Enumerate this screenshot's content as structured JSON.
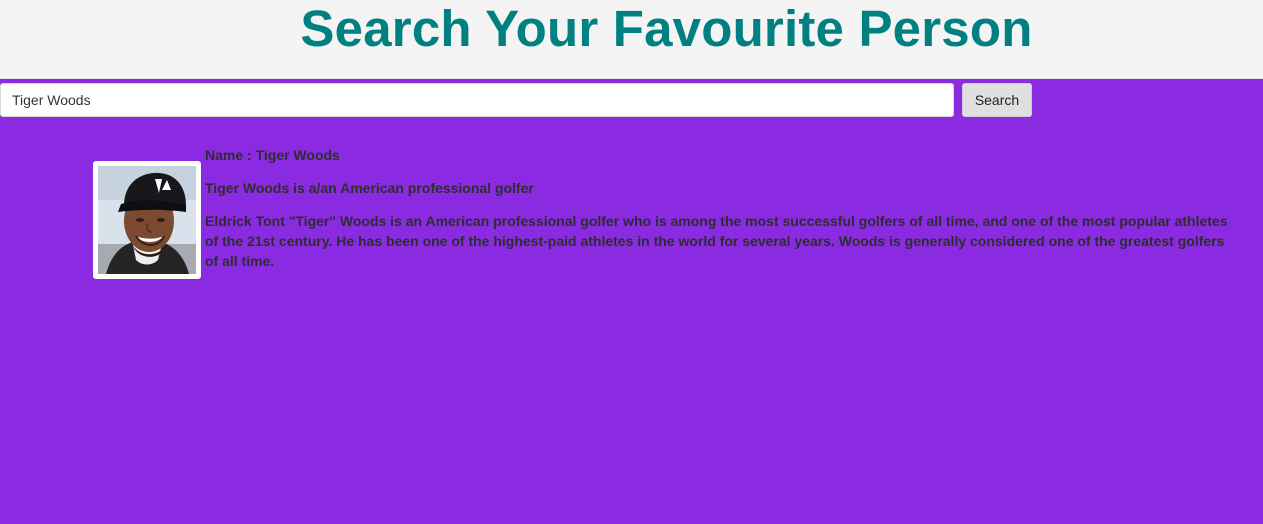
{
  "header": {
    "title": "Search Your Favourite Person"
  },
  "search": {
    "value": "Tiger Woods",
    "placeholder": "",
    "button_label": "Search"
  },
  "result": {
    "name_line": "Name : Tiger Woods",
    "summary": "Tiger Woods is a/an American professional golfer",
    "description": "Eldrick Tont \"Tiger\" Woods is an American professional golfer who is among the most successful golfers of all time, and one of the most popular athletes of the 21st century. He has been one of the highest-paid athletes in the world for several years. Woods is generally considered one of the greatest golfers of all time.",
    "image_subject": "portrait of a smiling man wearing a black cap"
  },
  "colors": {
    "background": "#8a2be2",
    "header_background": "#f4f4f4",
    "title": "#008080",
    "button_background": "#dfdfdf",
    "text": "#2d2d2d"
  }
}
